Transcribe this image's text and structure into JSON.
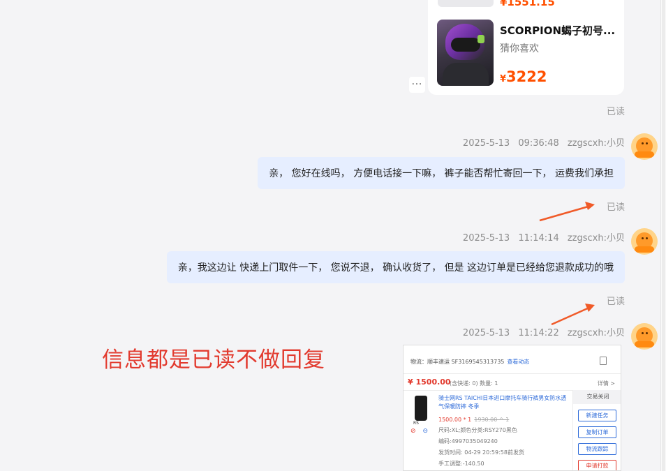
{
  "product_card": {
    "prev_price": "¥1551.15",
    "title": "SCORPION蝎子初号...",
    "subtitle": "猜你喜欢",
    "price_currency": "¥",
    "price": "3222"
  },
  "more_button": "···",
  "messages": [
    {
      "read": "已读"
    },
    {
      "time": "2025-5-13 09:36:48",
      "sender": "zzgscxh:小贝",
      "text": "亲， 您好在线吗， 方便电话接一下嘛， 裤子能否帮忙寄回一下， 运费我们承担",
      "read": "已读"
    },
    {
      "time": "2025-5-13 11:14:14",
      "sender": "zzgscxh:小贝",
      "text": "亲，我这边让 快递上门取件一下， 您说不退， 确认收货了， 但是 这边订单是已经给您退款成功的哦",
      "read": "已读"
    },
    {
      "time": "2025-5-13 11:14:22",
      "sender": "zzgscxh:小贝"
    }
  ],
  "annotation": "信息都是已读不做回复",
  "order_screenshot": {
    "logistics": "物流：顺丰速运  SF3169545313735",
    "track_link": "查看动态",
    "amount": "¥ 1500.00",
    "amount_meta": "(含快递: 0)  数量: 1",
    "detail_link": "详情 >",
    "product_title": "骑士网RS TAICHI日本进口摩托车骑行裤男女防水透气保暖防摔 冬季",
    "product_label": "RS",
    "product_price": "1500.00 * 1",
    "product_orig": "1930.00 ^ 1",
    "sku": "尺码:XL;颜色分类:RSY270黑色",
    "code": "编码:4997035049240",
    "ship_time": "发货时间: 04-29 20:59:58前发货",
    "manual_adjust": "手工调整:-140.50",
    "side_head": "交易关闭",
    "side_buttons": [
      "新建任务",
      "复制订单",
      "物流跟踪",
      "申请打款"
    ]
  },
  "colors": {
    "bubble": "#e6eeff",
    "price": "#ff5000",
    "annotation": "#e23a2e",
    "arrow": "#f05a28"
  }
}
